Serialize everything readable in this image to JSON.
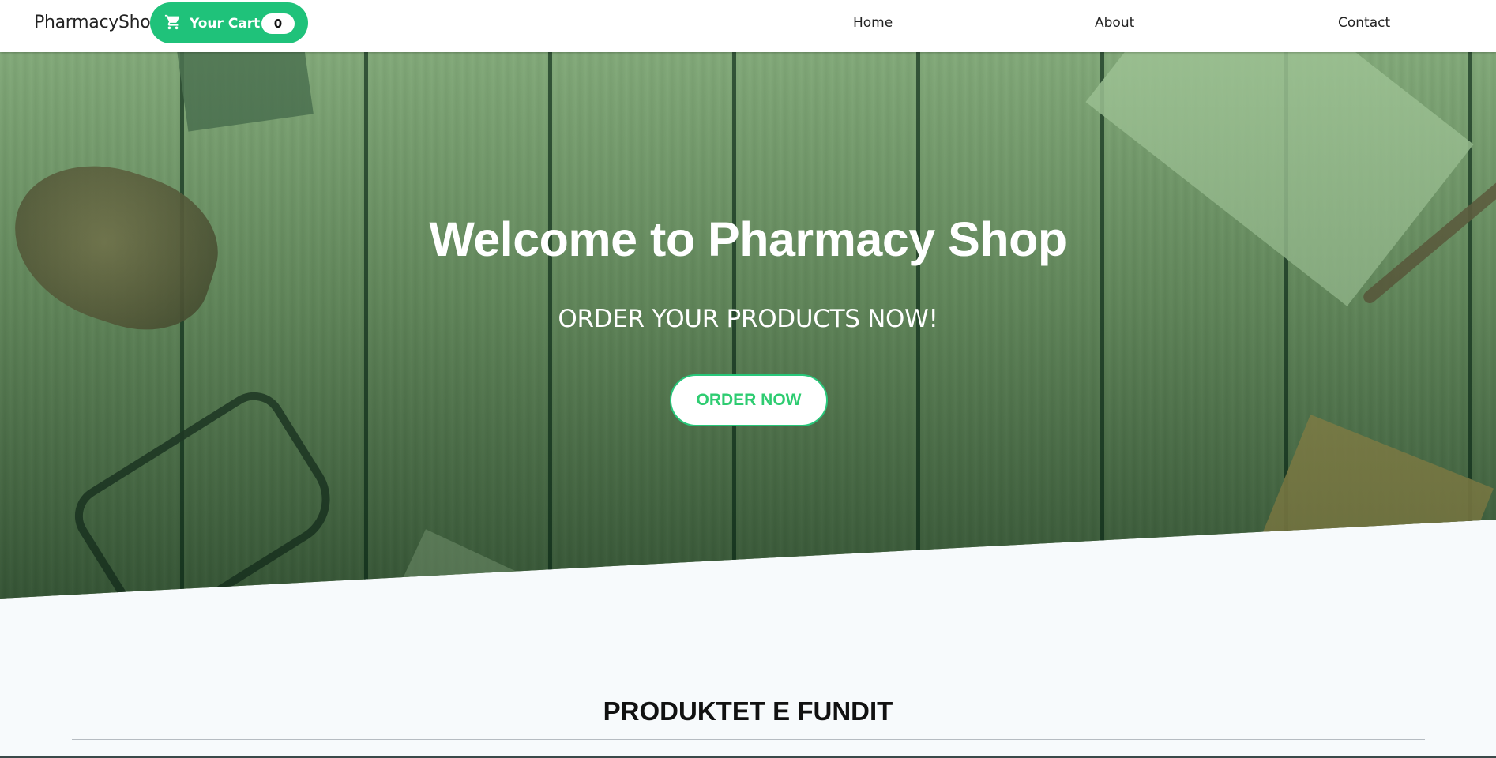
{
  "navbar": {
    "brand": "PharmacyShop",
    "cart": {
      "label": "Your Cart",
      "count": "0",
      "icon": "cart-icon"
    },
    "links": [
      {
        "label": "Home"
      },
      {
        "label": "About"
      },
      {
        "label": "Contact"
      }
    ]
  },
  "hero": {
    "title": "Welcome to Pharmacy Shop",
    "subtitle": "ORDER YOUR PRODUCTS NOW!",
    "cta_label": "ORDER NOW"
  },
  "section": {
    "title": "PRODUKTET E FUNDIT"
  },
  "colors": {
    "accent": "#1fc27a",
    "cta_text": "#2ecc71",
    "page_bg": "#f7fafc"
  }
}
